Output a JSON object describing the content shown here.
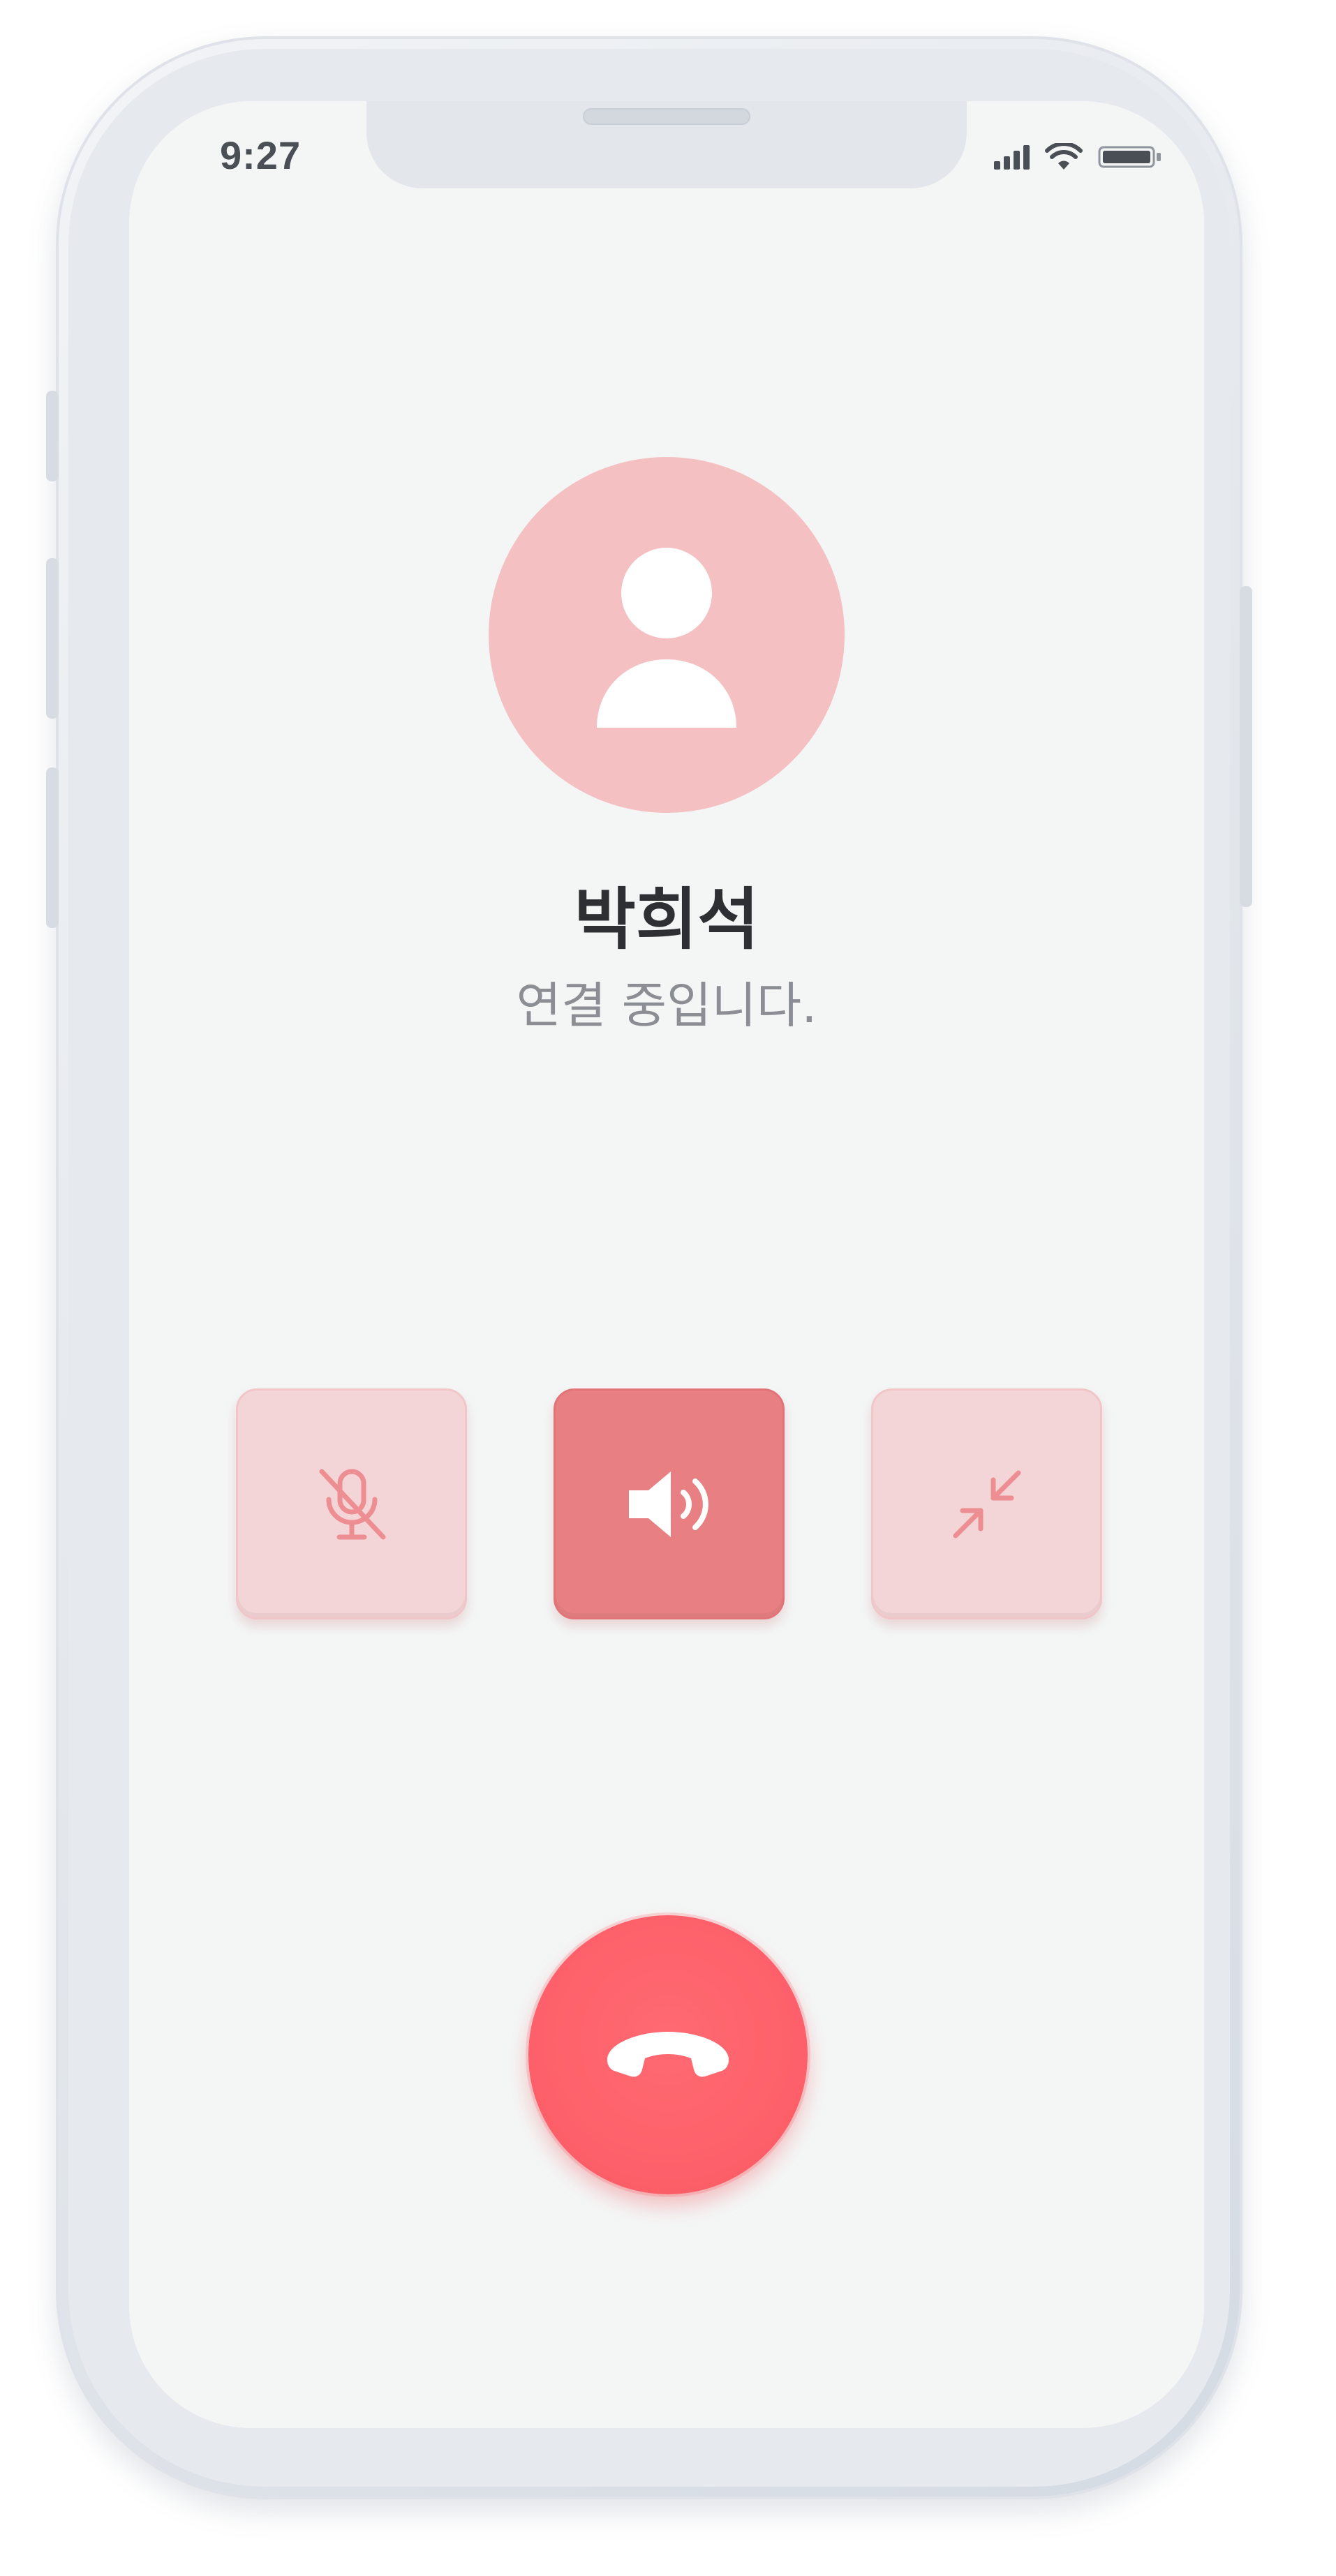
{
  "status_bar": {
    "time": "9:27",
    "icons": [
      "signal-icon",
      "wifi-icon",
      "battery-icon"
    ]
  },
  "call": {
    "caller_name": "박희석",
    "status_text": "연결 중입니다."
  },
  "controls": [
    {
      "name": "mute",
      "icon": "mic-off-icon",
      "active": false
    },
    {
      "name": "speaker",
      "icon": "speaker-icon",
      "active": true
    },
    {
      "name": "minimize",
      "icon": "minimize-icon",
      "active": false
    }
  ],
  "end_call": {
    "icon": "end-call-icon"
  },
  "colors": {
    "accent": "#fd5f69",
    "avatar_bg": "#f4c0c1",
    "button_inactive": "#f4d5d7",
    "button_active": "#e88083",
    "screen_bg": "#f4f6f6"
  }
}
